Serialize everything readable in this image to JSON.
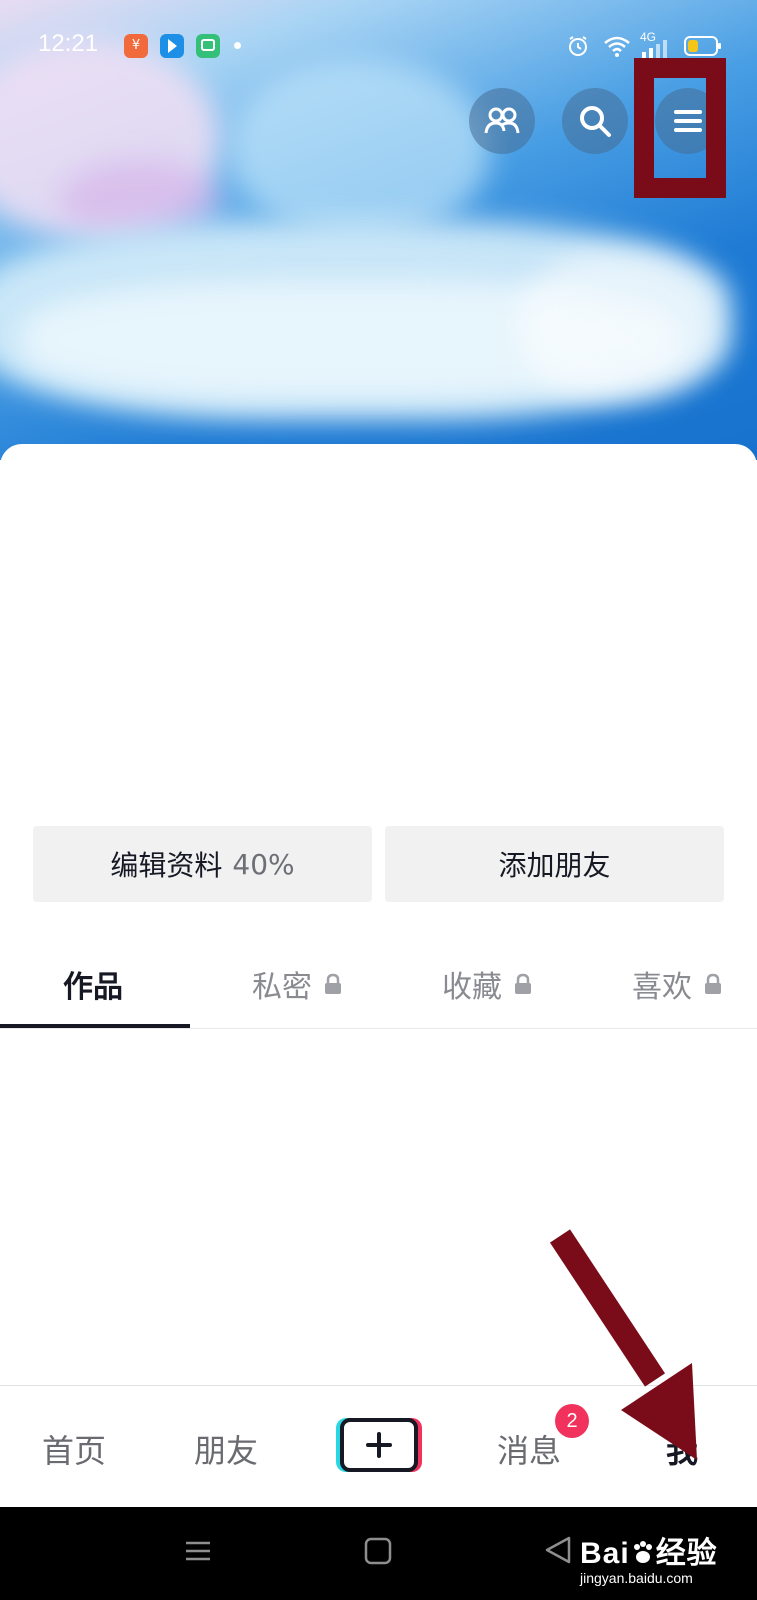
{
  "status_bar": {
    "time": "12:21",
    "network": "4G",
    "app_icons": [
      "wallet-icon",
      "pin-icon",
      "chat-icon"
    ],
    "system_icons": [
      "alarm-icon",
      "wifi-icon",
      "signal-icon",
      "battery-icon"
    ]
  },
  "header": {
    "icons": [
      "friends-icon",
      "search-icon",
      "menu-icon"
    ]
  },
  "profile": {
    "edit_label": "编辑资料",
    "edit_percent": "40%",
    "add_friends_label": "添加朋友"
  },
  "tabs": [
    {
      "label": "作品",
      "active": true,
      "locked": false
    },
    {
      "label": "私密",
      "active": false,
      "locked": true
    },
    {
      "label": "收藏",
      "active": false,
      "locked": true
    },
    {
      "label": "喜欢",
      "active": false,
      "locked": true
    }
  ],
  "bottom_nav": {
    "items": [
      "首页",
      "朋友",
      "消息",
      "我"
    ],
    "create_icon": "plus-icon",
    "messages_badge": "2",
    "active": "我"
  },
  "system_nav": {
    "icons": [
      "recent-apps-icon",
      "home-icon",
      "back-icon"
    ]
  },
  "watermark": {
    "brand": "Bai",
    "brand_suffix": "经验",
    "url": "jingyan.baidu.com"
  },
  "colors": {
    "accent": "#f0325c",
    "text_primary": "#161823",
    "text_secondary": "#8a8b91",
    "annotation": "#7a0c1a"
  }
}
